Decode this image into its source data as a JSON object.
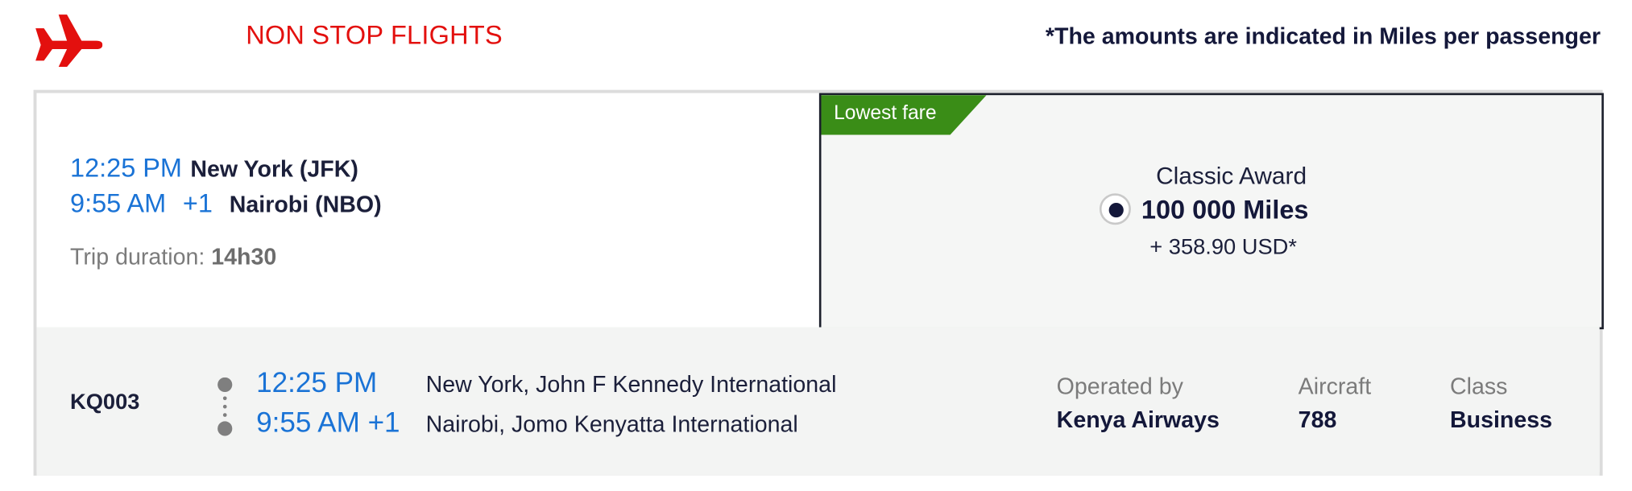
{
  "header": {
    "plane_icon": "airplane-icon",
    "title": "NON STOP FLIGHTS",
    "note": "*The amounts are indicated in Miles per passenger"
  },
  "summary": {
    "departure_time": "12:25 PM",
    "departure_city": "New York (JFK)",
    "arrival_time": "9:55 AM",
    "arrival_day_offset": "+1",
    "arrival_city": "Nairobi (NBO)",
    "duration_label": "Trip duration:",
    "duration_value": "14h30"
  },
  "fare": {
    "tag": "Lowest fare",
    "type": "Classic Award",
    "miles": "100 000 Miles",
    "usd": "+ 358.90 USD*",
    "selected": true,
    "tag_color": "#3a8d17"
  },
  "segment": {
    "flight_number": "KQ003",
    "departure_time": "12:25 PM",
    "arrival_time": "9:55 AM +1",
    "departure_airport": "New York, John F Kennedy International",
    "arrival_airport": "Nairobi, Jomo Kenyatta International",
    "operated_by_label": "Operated by",
    "operated_by_value": "Kenya Airways",
    "aircraft_label": "Aircraft",
    "aircraft_value": "788",
    "class_label": "Class",
    "class_value": "Business"
  },
  "colors": {
    "brand_red": "#e3100e",
    "time_blue": "#1a73d6",
    "dark_navy": "#14183a",
    "muted_gray": "#7b7b7b"
  }
}
